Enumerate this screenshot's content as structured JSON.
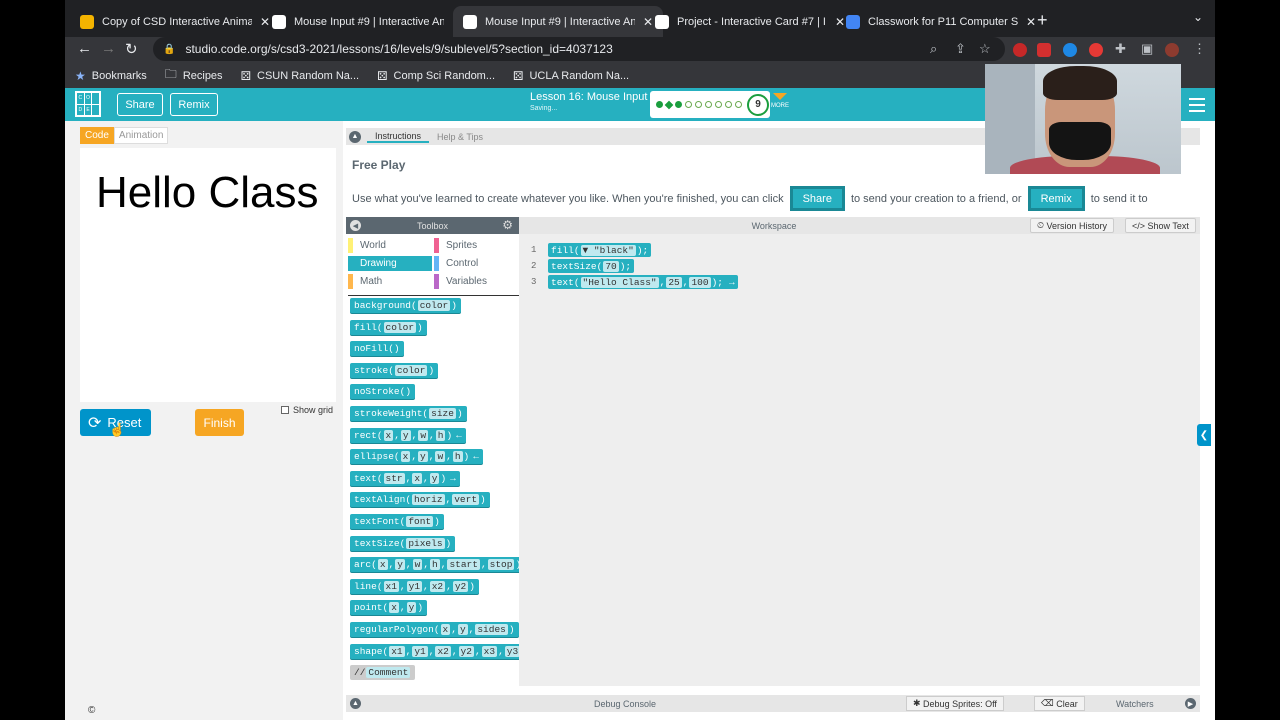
{
  "browser": {
    "tabs": [
      {
        "title": "Copy of CSD Interactive Anima",
        "favicon_color": "#f4b400"
      },
      {
        "title": "Mouse Input #9 | Interactive An",
        "favicon_color": "#ffffff"
      },
      {
        "title": "Mouse Input #9 | Interactive An",
        "favicon_color": "#ffffff",
        "active": true
      },
      {
        "title": "Project - Interactive Card #7 | I",
        "favicon_color": "#ffffff"
      },
      {
        "title": "Classwork for P11 Computer Sc",
        "favicon_color": "#4285f4"
      }
    ],
    "tab_close": "✕",
    "new_tab": "+",
    "url": "studio.code.org/s/csd3-2021/lessons/16/levels/9/sublevel/5?section_id=4037123",
    "bookmarks": [
      {
        "label": "Bookmarks",
        "icon": "star-icon"
      },
      {
        "label": "Recipes",
        "icon": "folder-icon"
      },
      {
        "label": "CSUN Random Na...",
        "icon": "dice-icon"
      },
      {
        "label": "Comp Sci Random...",
        "icon": "dice-icon"
      },
      {
        "label": "UCLA Random Na...",
        "icon": "dice-icon"
      }
    ]
  },
  "header": {
    "logo_letters": [
      "C",
      "O",
      "D",
      "E"
    ],
    "share_label": "Share",
    "remix_label": "Remix",
    "lesson_title": "Lesson 16: Mouse Input",
    "status": "Saving...",
    "level_number": "9",
    "more_label": "MORE",
    "accent_color": "#26b0c0"
  },
  "viz": {
    "tab_code": "Code",
    "tab_animation": "Animation",
    "canvas_text": "Hello Class",
    "reset_label": "Reset",
    "finish_label": "Finish",
    "show_grid_label": "Show grid",
    "copyright": "©"
  },
  "instructions": {
    "tab_instructions": "Instructions",
    "tab_help": "Help & Tips",
    "title": "Free Play",
    "text_1": "Use what you've learned to create whatever you like. When you're finished, you can click",
    "share_btn": "Share",
    "text_2": "to send your creation to a friend, or",
    "remix_btn": "Remix",
    "text_3": "to send it to"
  },
  "toolbox": {
    "title": "Toolbox",
    "categories": [
      {
        "label": "World",
        "color": "#fff176"
      },
      {
        "label": "Sprites",
        "color": "#f06292"
      },
      {
        "label": "Drawing",
        "color": "#26b0c0",
        "selected": true
      },
      {
        "label": "Control",
        "color": "#64b5f6"
      },
      {
        "label": "Math",
        "color": "#ffb74d"
      },
      {
        "label": "Variables",
        "color": "#ba68c8"
      }
    ],
    "blocks": [
      {
        "name": "background",
        "params": [
          "color"
        ]
      },
      {
        "name": "fill",
        "params": [
          "color"
        ]
      },
      {
        "name": "noFill",
        "params": []
      },
      {
        "name": "stroke",
        "params": [
          "color"
        ]
      },
      {
        "name": "noStroke",
        "params": []
      },
      {
        "name": "strokeWeight",
        "params": [
          "size"
        ]
      },
      {
        "name": "rect",
        "params": [
          "x",
          "y",
          "w",
          "h"
        ],
        "arrow": "←"
      },
      {
        "name": "ellipse",
        "params": [
          "x",
          "y",
          "w",
          "h"
        ],
        "arrow": "←"
      },
      {
        "name": "text",
        "params": [
          "str",
          "x",
          "y"
        ],
        "arrow": "→"
      },
      {
        "name": "textAlign",
        "params": [
          "horiz",
          "vert"
        ]
      },
      {
        "name": "textFont",
        "params": [
          "font"
        ]
      },
      {
        "name": "textSize",
        "params": [
          "pixels"
        ]
      },
      {
        "name": "arc",
        "params": [
          "x",
          "y",
          "w",
          "h",
          "start",
          "stop"
        ]
      },
      {
        "name": "line",
        "params": [
          "x1",
          "y1",
          "x2",
          "y2"
        ]
      },
      {
        "name": "point",
        "params": [
          "x",
          "y"
        ]
      },
      {
        "name": "regularPolygon",
        "params": [
          "x",
          "y",
          "sides"
        ]
      },
      {
        "name": "shape",
        "params": [
          "x1",
          "y1",
          "x2",
          "y2",
          "x3",
          "y3"
        ]
      },
      {
        "name": "//",
        "params": [
          "Comment"
        ],
        "comment": true
      }
    ]
  },
  "workspace": {
    "title": "Workspace",
    "version_history": "Version History",
    "show_text": "Show Text",
    "lines": [
      {
        "num": "1",
        "name": "fill",
        "args": [
          "▼ \"black\""
        ]
      },
      {
        "num": "2",
        "name": "textSize",
        "args": [
          "70"
        ]
      },
      {
        "num": "3",
        "name": "text",
        "args": [
          "\"Hello Class\"",
          "25",
          "100"
        ],
        "arrow": "→"
      }
    ]
  },
  "debug": {
    "title": "Debug Console",
    "sprites_btn": "Debug Sprites: Off",
    "clear_btn": "Clear",
    "watchers": "Watchers"
  }
}
